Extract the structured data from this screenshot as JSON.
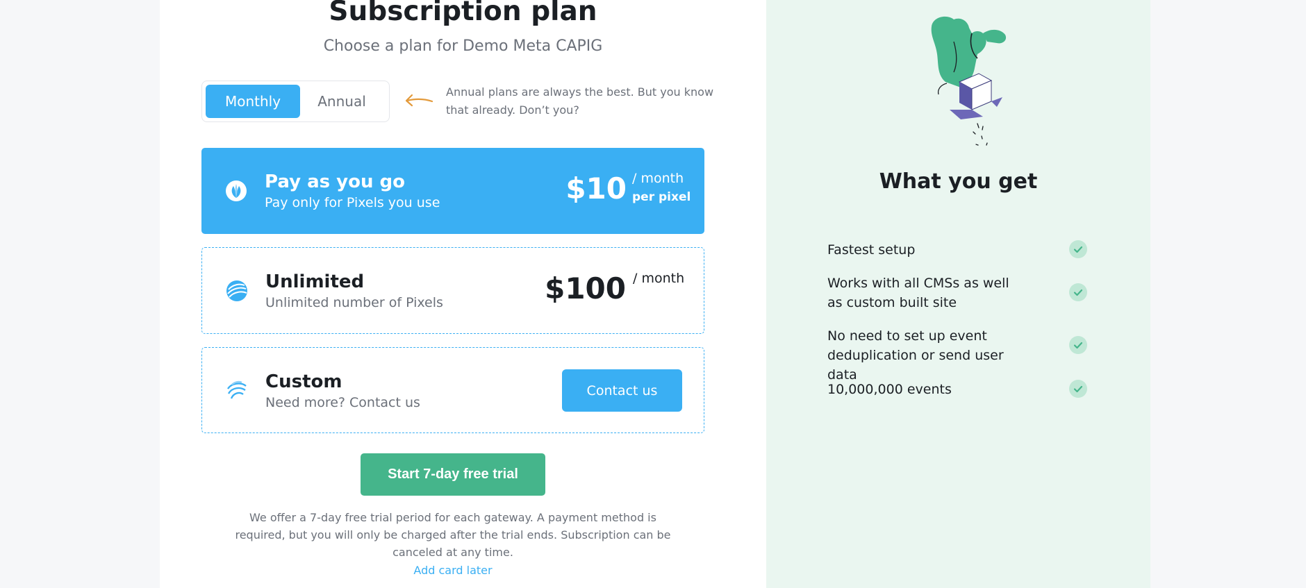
{
  "header": {
    "title": "Subscription plan",
    "subtitle": "Choose a plan for Demo Meta CAPIG"
  },
  "billing": {
    "monthly_label": "Monthly",
    "annual_label": "Annual",
    "selected": "Monthly",
    "hint": "Annual plans are always the best. But you know that already. Don’t you?"
  },
  "plans": [
    {
      "name": "Pay as you go",
      "description": "Pay only for Pixels you use",
      "price": "$10",
      "unit": "/ month",
      "sub_unit": "per pixel",
      "selected": true
    },
    {
      "name": "Unlimited",
      "description": "Unlimited number of Pixels",
      "price": "$100",
      "unit": "/ month",
      "selected": false
    },
    {
      "name": "Custom",
      "description": "Need more? Contact us",
      "button_label": "Contact us",
      "selected": false
    }
  ],
  "trial": {
    "button_label": "Start 7-day free trial",
    "note": "We offer a 7-day free trial period for each gateway. A payment method is required, but you will only be charged after the trial ends. Subscription can be canceled at any time.",
    "add_card_label": "Add card later"
  },
  "benefits": {
    "title": "What you get",
    "items": [
      "Fastest setup",
      "Works with all CMSs as well as custom built site",
      "No need to set up event deduplication or send user data",
      "10,000,000 events"
    ]
  },
  "colors": {
    "accent_blue": "#3aaff3",
    "accent_green": "#45b58b",
    "panel_green": "#eaf6f0"
  },
  "icons": {
    "pay_as_you_go": "leaf-icon",
    "unlimited": "globe-icon",
    "custom": "waves-icon",
    "hint": "arrow-left-icon",
    "benefit": "check-circle-icon"
  }
}
